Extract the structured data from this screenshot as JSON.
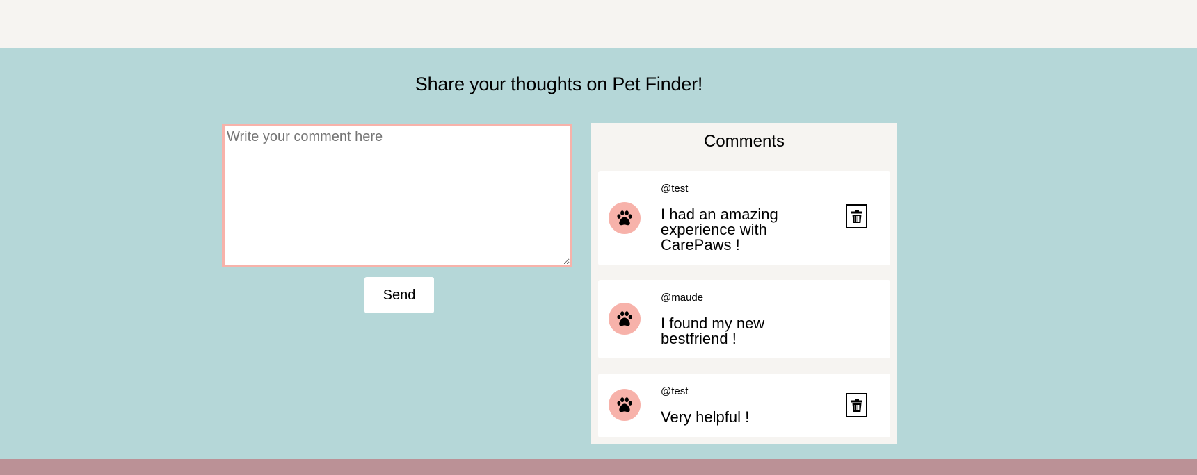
{
  "page": {
    "title": "Share your thoughts on Pet Finder!"
  },
  "form": {
    "comment_placeholder": "Write your comment here",
    "comment_value": "",
    "send_label": "Send"
  },
  "comments_panel": {
    "title": "Comments",
    "comments": [
      {
        "username": "@test",
        "text": "I had an amazing experience with CarePaws !",
        "avatar_icon": "paw-icon",
        "deletable": true
      },
      {
        "username": "@maude",
        "text": "I found my new bestfriend !",
        "avatar_icon": "paw-icon",
        "deletable": false
      },
      {
        "username": "@test",
        "text": "Very helpful !",
        "avatar_icon": "paw-icon",
        "deletable": true
      }
    ]
  },
  "colors": {
    "main_background": "#b5d7d8",
    "top_background": "#f6f4f1",
    "footer_band": "#bb9196",
    "accent_pink": "#f7b2aa",
    "panel_background": "#f6f4f1"
  }
}
